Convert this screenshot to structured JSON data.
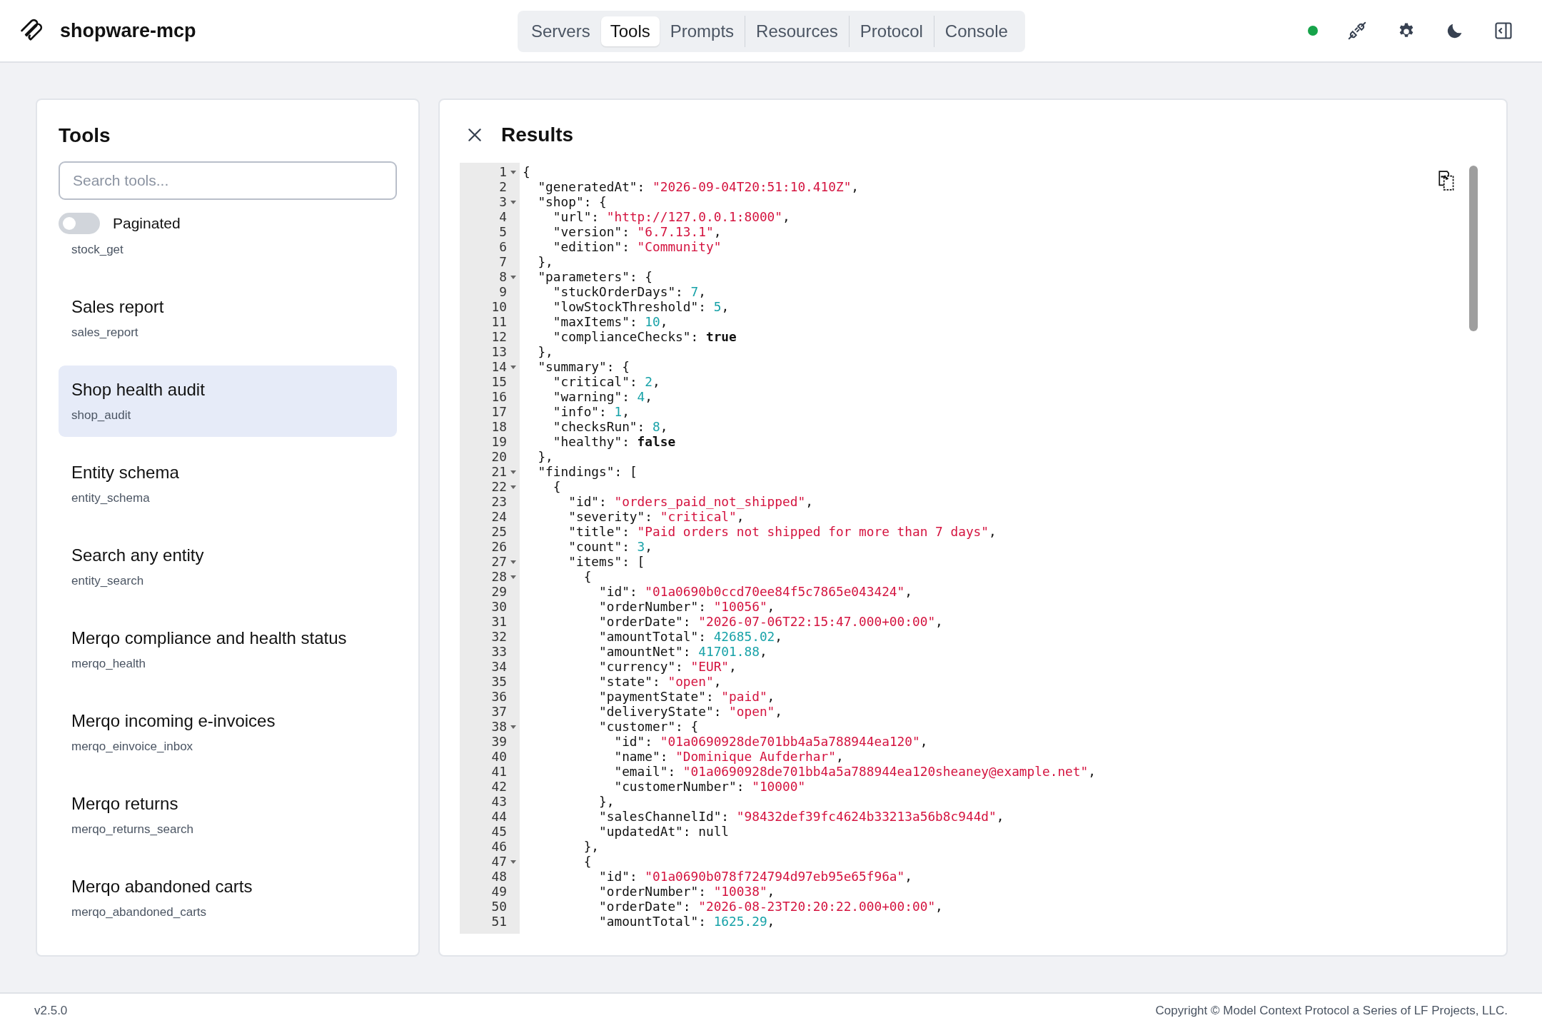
{
  "app": {
    "name": "shopware-mcp",
    "connected": true
  },
  "nav": [
    {
      "label": "Servers",
      "selected": false
    },
    {
      "label": "Tools",
      "selected": true
    },
    {
      "label": "Prompts",
      "selected": false
    },
    {
      "label": "Resources",
      "selected": false
    },
    {
      "label": "Protocol",
      "selected": false
    },
    {
      "label": "Console",
      "selected": false
    }
  ],
  "tools": {
    "title": "Tools",
    "search": {
      "placeholder": "Search tools..."
    },
    "paginated": {
      "label": "Paginated",
      "on": false
    },
    "items": [
      {
        "slug": "stock_get",
        "selected": false
      },
      {
        "name": "Sales report",
        "slug": "sales_report",
        "selected": false
      },
      {
        "name": "Shop health audit",
        "slug": "shop_audit",
        "selected": true
      },
      {
        "name": "Entity schema",
        "slug": "entity_schema",
        "selected": false
      },
      {
        "name": "Search any entity",
        "slug": "entity_search",
        "selected": false
      },
      {
        "name": "Merqo compliance and health status",
        "slug": "merqo_health",
        "selected": false
      },
      {
        "name": "Merqo incoming e-invoices",
        "slug": "merqo_einvoice_inbox",
        "selected": false
      },
      {
        "name": "Merqo returns",
        "slug": "merqo_returns_search",
        "selected": false
      },
      {
        "name": "Merqo abandoned carts",
        "slug": "merqo_abandoned_carts",
        "selected": false
      }
    ]
  },
  "results": {
    "title": "Results",
    "lines": [
      {
        "number": "1",
        "fold": true,
        "tokens": [
          {
            "kind": "punct",
            "text": "{"
          }
        ]
      },
      {
        "number": "2",
        "fold": false,
        "tokens": [
          {
            "kind": "key",
            "text": "  \"generatedAt\""
          },
          {
            "kind": "punct",
            "text": ": "
          },
          {
            "kind": "str",
            "text": "\"2026-09-04T20:51:10.410Z\""
          },
          {
            "kind": "punct",
            "text": ","
          }
        ]
      },
      {
        "number": "3",
        "fold": true,
        "tokens": [
          {
            "kind": "key",
            "text": "  \"shop\""
          },
          {
            "kind": "punct",
            "text": ": {"
          }
        ]
      },
      {
        "number": "4",
        "fold": false,
        "tokens": [
          {
            "kind": "key",
            "text": "    \"url\""
          },
          {
            "kind": "punct",
            "text": ": "
          },
          {
            "kind": "str",
            "text": "\"http://127.0.0.1:8000\""
          },
          {
            "kind": "punct",
            "text": ","
          }
        ]
      },
      {
        "number": "5",
        "fold": false,
        "tokens": [
          {
            "kind": "key",
            "text": "    \"version\""
          },
          {
            "kind": "punct",
            "text": ": "
          },
          {
            "kind": "str",
            "text": "\"6.7.13.1\""
          },
          {
            "kind": "punct",
            "text": ","
          }
        ]
      },
      {
        "number": "6",
        "fold": false,
        "tokens": [
          {
            "kind": "key",
            "text": "    \"edition\""
          },
          {
            "kind": "punct",
            "text": ": "
          },
          {
            "kind": "str",
            "text": "\"Community\""
          }
        ]
      },
      {
        "number": "7",
        "fold": false,
        "tokens": [
          {
            "kind": "punct",
            "text": "  },"
          }
        ]
      },
      {
        "number": "8",
        "fold": true,
        "tokens": [
          {
            "kind": "key",
            "text": "  \"parameters\""
          },
          {
            "kind": "punct",
            "text": ": {"
          }
        ]
      },
      {
        "number": "9",
        "fold": false,
        "tokens": [
          {
            "kind": "key",
            "text": "    \"stuckOrderDays\""
          },
          {
            "kind": "punct",
            "text": ": "
          },
          {
            "kind": "num",
            "text": "7"
          },
          {
            "kind": "punct",
            "text": ","
          }
        ]
      },
      {
        "number": "10",
        "fold": false,
        "tokens": [
          {
            "kind": "key",
            "text": "    \"lowStockThreshold\""
          },
          {
            "kind": "punct",
            "text": ": "
          },
          {
            "kind": "num",
            "text": "5"
          },
          {
            "kind": "punct",
            "text": ","
          }
        ]
      },
      {
        "number": "11",
        "fold": false,
        "tokens": [
          {
            "kind": "key",
            "text": "    \"maxItems\""
          },
          {
            "kind": "punct",
            "text": ": "
          },
          {
            "kind": "num",
            "text": "10"
          },
          {
            "kind": "punct",
            "text": ","
          }
        ]
      },
      {
        "number": "12",
        "fold": false,
        "tokens": [
          {
            "kind": "key",
            "text": "    \"complianceChecks\""
          },
          {
            "kind": "punct",
            "text": ": "
          },
          {
            "kind": "bool",
            "text": "true"
          }
        ]
      },
      {
        "number": "13",
        "fold": false,
        "tokens": [
          {
            "kind": "punct",
            "text": "  },"
          }
        ]
      },
      {
        "number": "14",
        "fold": true,
        "tokens": [
          {
            "kind": "key",
            "text": "  \"summary\""
          },
          {
            "kind": "punct",
            "text": ": {"
          }
        ]
      },
      {
        "number": "15",
        "fold": false,
        "tokens": [
          {
            "kind": "key",
            "text": "    \"critical\""
          },
          {
            "kind": "punct",
            "text": ": "
          },
          {
            "kind": "num",
            "text": "2"
          },
          {
            "kind": "punct",
            "text": ","
          }
        ]
      },
      {
        "number": "16",
        "fold": false,
        "tokens": [
          {
            "kind": "key",
            "text": "    \"warning\""
          },
          {
            "kind": "punct",
            "text": ": "
          },
          {
            "kind": "num",
            "text": "4"
          },
          {
            "kind": "punct",
            "text": ","
          }
        ]
      },
      {
        "number": "17",
        "fold": false,
        "tokens": [
          {
            "kind": "key",
            "text": "    \"info\""
          },
          {
            "kind": "punct",
            "text": ": "
          },
          {
            "kind": "num",
            "text": "1"
          },
          {
            "kind": "punct",
            "text": ","
          }
        ]
      },
      {
        "number": "18",
        "fold": false,
        "tokens": [
          {
            "kind": "key",
            "text": "    \"checksRun\""
          },
          {
            "kind": "punct",
            "text": ": "
          },
          {
            "kind": "num",
            "text": "8"
          },
          {
            "kind": "punct",
            "text": ","
          }
        ]
      },
      {
        "number": "19",
        "fold": false,
        "tokens": [
          {
            "kind": "key",
            "text": "    \"healthy\""
          },
          {
            "kind": "punct",
            "text": ": "
          },
          {
            "kind": "bool",
            "text": "false"
          }
        ]
      },
      {
        "number": "20",
        "fold": false,
        "tokens": [
          {
            "kind": "punct",
            "text": "  },"
          }
        ]
      },
      {
        "number": "21",
        "fold": true,
        "tokens": [
          {
            "kind": "key",
            "text": "  \"findings\""
          },
          {
            "kind": "punct",
            "text": ": ["
          }
        ]
      },
      {
        "number": "22",
        "fold": true,
        "tokens": [
          {
            "kind": "punct",
            "text": "    {"
          }
        ]
      },
      {
        "number": "23",
        "fold": false,
        "tokens": [
          {
            "kind": "key",
            "text": "      \"id\""
          },
          {
            "kind": "punct",
            "text": ": "
          },
          {
            "kind": "str",
            "text": "\"orders_paid_not_shipped\""
          },
          {
            "kind": "punct",
            "text": ","
          }
        ]
      },
      {
        "number": "24",
        "fold": false,
        "tokens": [
          {
            "kind": "key",
            "text": "      \"severity\""
          },
          {
            "kind": "punct",
            "text": ": "
          },
          {
            "kind": "str",
            "text": "\"critical\""
          },
          {
            "kind": "punct",
            "text": ","
          }
        ]
      },
      {
        "number": "25",
        "fold": false,
        "tokens": [
          {
            "kind": "key",
            "text": "      \"title\""
          },
          {
            "kind": "punct",
            "text": ": "
          },
          {
            "kind": "str",
            "text": "\"Paid orders not shipped for more than 7 days\""
          },
          {
            "kind": "punct",
            "text": ","
          }
        ]
      },
      {
        "number": "26",
        "fold": false,
        "tokens": [
          {
            "kind": "key",
            "text": "      \"count\""
          },
          {
            "kind": "punct",
            "text": ": "
          },
          {
            "kind": "num",
            "text": "3"
          },
          {
            "kind": "punct",
            "text": ","
          }
        ]
      },
      {
        "number": "27",
        "fold": true,
        "tokens": [
          {
            "kind": "key",
            "text": "      \"items\""
          },
          {
            "kind": "punct",
            "text": ": ["
          }
        ]
      },
      {
        "number": "28",
        "fold": true,
        "tokens": [
          {
            "kind": "punct",
            "text": "        {"
          }
        ]
      },
      {
        "number": "29",
        "fold": false,
        "tokens": [
          {
            "kind": "key",
            "text": "          \"id\""
          },
          {
            "kind": "punct",
            "text": ": "
          },
          {
            "kind": "str",
            "text": "\"01a0690b0ccd70ee84f5c7865e043424\""
          },
          {
            "kind": "punct",
            "text": ","
          }
        ]
      },
      {
        "number": "30",
        "fold": false,
        "tokens": [
          {
            "kind": "key",
            "text": "          \"orderNumber\""
          },
          {
            "kind": "punct",
            "text": ": "
          },
          {
            "kind": "str",
            "text": "\"10056\""
          },
          {
            "kind": "punct",
            "text": ","
          }
        ]
      },
      {
        "number": "31",
        "fold": false,
        "tokens": [
          {
            "kind": "key",
            "text": "          \"orderDate\""
          },
          {
            "kind": "punct",
            "text": ": "
          },
          {
            "kind": "str",
            "text": "\"2026-07-06T22:15:47.000+00:00\""
          },
          {
            "kind": "punct",
            "text": ","
          }
        ]
      },
      {
        "number": "32",
        "fold": false,
        "tokens": [
          {
            "kind": "key",
            "text": "          \"amountTotal\""
          },
          {
            "kind": "punct",
            "text": ": "
          },
          {
            "kind": "num",
            "text": "42685.02"
          },
          {
            "kind": "punct",
            "text": ","
          }
        ]
      },
      {
        "number": "33",
        "fold": false,
        "tokens": [
          {
            "kind": "key",
            "text": "          \"amountNet\""
          },
          {
            "kind": "punct",
            "text": ": "
          },
          {
            "kind": "num",
            "text": "41701.88"
          },
          {
            "kind": "punct",
            "text": ","
          }
        ]
      },
      {
        "number": "34",
        "fold": false,
        "tokens": [
          {
            "kind": "key",
            "text": "          \"currency\""
          },
          {
            "kind": "punct",
            "text": ": "
          },
          {
            "kind": "str",
            "text": "\"EUR\""
          },
          {
            "kind": "punct",
            "text": ","
          }
        ]
      },
      {
        "number": "35",
        "fold": false,
        "tokens": [
          {
            "kind": "key",
            "text": "          \"state\""
          },
          {
            "kind": "punct",
            "text": ": "
          },
          {
            "kind": "str",
            "text": "\"open\""
          },
          {
            "kind": "punct",
            "text": ","
          }
        ]
      },
      {
        "number": "36",
        "fold": false,
        "tokens": [
          {
            "kind": "key",
            "text": "          \"paymentState\""
          },
          {
            "kind": "punct",
            "text": ": "
          },
          {
            "kind": "str",
            "text": "\"paid\""
          },
          {
            "kind": "punct",
            "text": ","
          }
        ]
      },
      {
        "number": "37",
        "fold": false,
        "tokens": [
          {
            "kind": "key",
            "text": "          \"deliveryState\""
          },
          {
            "kind": "punct",
            "text": ": "
          },
          {
            "kind": "str",
            "text": "\"open\""
          },
          {
            "kind": "punct",
            "text": ","
          }
        ]
      },
      {
        "number": "38",
        "fold": true,
        "tokens": [
          {
            "kind": "key",
            "text": "          \"customer\""
          },
          {
            "kind": "punct",
            "text": ": {"
          }
        ]
      },
      {
        "number": "39",
        "fold": false,
        "tokens": [
          {
            "kind": "key",
            "text": "            \"id\""
          },
          {
            "kind": "punct",
            "text": ": "
          },
          {
            "kind": "str",
            "text": "\"01a0690928de701bb4a5a788944ea120\""
          },
          {
            "kind": "punct",
            "text": ","
          }
        ]
      },
      {
        "number": "40",
        "fold": false,
        "tokens": [
          {
            "kind": "key",
            "text": "            \"name\""
          },
          {
            "kind": "punct",
            "text": ": "
          },
          {
            "kind": "str",
            "text": "\"Dominique Aufderhar\""
          },
          {
            "kind": "punct",
            "text": ","
          }
        ]
      },
      {
        "number": "41",
        "fold": false,
        "tokens": [
          {
            "kind": "key",
            "text": "            \"email\""
          },
          {
            "kind": "punct",
            "text": ": "
          },
          {
            "kind": "str",
            "text": "\"01a0690928de701bb4a5a788944ea120sheaney@example.net\""
          },
          {
            "kind": "punct",
            "text": ","
          }
        ]
      },
      {
        "number": "42",
        "fold": false,
        "tokens": [
          {
            "kind": "key",
            "text": "            \"customerNumber\""
          },
          {
            "kind": "punct",
            "text": ": "
          },
          {
            "kind": "str",
            "text": "\"10000\""
          }
        ]
      },
      {
        "number": "43",
        "fold": false,
        "tokens": [
          {
            "kind": "punct",
            "text": "          },"
          }
        ]
      },
      {
        "number": "44",
        "fold": false,
        "tokens": [
          {
            "kind": "key",
            "text": "          \"salesChannelId\""
          },
          {
            "kind": "punct",
            "text": ": "
          },
          {
            "kind": "str",
            "text": "\"98432def39fc4624b33213a56b8c944d\""
          },
          {
            "kind": "punct",
            "text": ","
          }
        ]
      },
      {
        "number": "45",
        "fold": false,
        "tokens": [
          {
            "kind": "key",
            "text": "          \"updatedAt\""
          },
          {
            "kind": "punct",
            "text": ": "
          },
          {
            "kind": "null",
            "text": "null"
          }
        ]
      },
      {
        "number": "46",
        "fold": false,
        "tokens": [
          {
            "kind": "punct",
            "text": "        },"
          }
        ]
      },
      {
        "number": "47",
        "fold": true,
        "tokens": [
          {
            "kind": "punct",
            "text": "        {"
          }
        ]
      },
      {
        "number": "48",
        "fold": false,
        "tokens": [
          {
            "kind": "key",
            "text": "          \"id\""
          },
          {
            "kind": "punct",
            "text": ": "
          },
          {
            "kind": "str",
            "text": "\"01a0690b078f724794d97eb95e65f96a\""
          },
          {
            "kind": "punct",
            "text": ","
          }
        ]
      },
      {
        "number": "49",
        "fold": false,
        "tokens": [
          {
            "kind": "key",
            "text": "          \"orderNumber\""
          },
          {
            "kind": "punct",
            "text": ": "
          },
          {
            "kind": "str",
            "text": "\"10038\""
          },
          {
            "kind": "punct",
            "text": ","
          }
        ]
      },
      {
        "number": "50",
        "fold": false,
        "tokens": [
          {
            "kind": "key",
            "text": "          \"orderDate\""
          },
          {
            "kind": "punct",
            "text": ": "
          },
          {
            "kind": "str",
            "text": "\"2026-08-23T20:20:22.000+00:00\""
          },
          {
            "kind": "punct",
            "text": ","
          }
        ]
      },
      {
        "number": "51",
        "fold": false,
        "tokens": [
          {
            "kind": "key",
            "text": "          \"amountTotal\""
          },
          {
            "kind": "punct",
            "text": ": "
          },
          {
            "kind": "num",
            "text": "1625.29"
          },
          {
            "kind": "punct",
            "text": ","
          }
        ]
      }
    ]
  },
  "footer": {
    "version": "v2.5.0",
    "copyright": "Copyright © Model Context Protocol a Series of LF Projects, LLC."
  }
}
